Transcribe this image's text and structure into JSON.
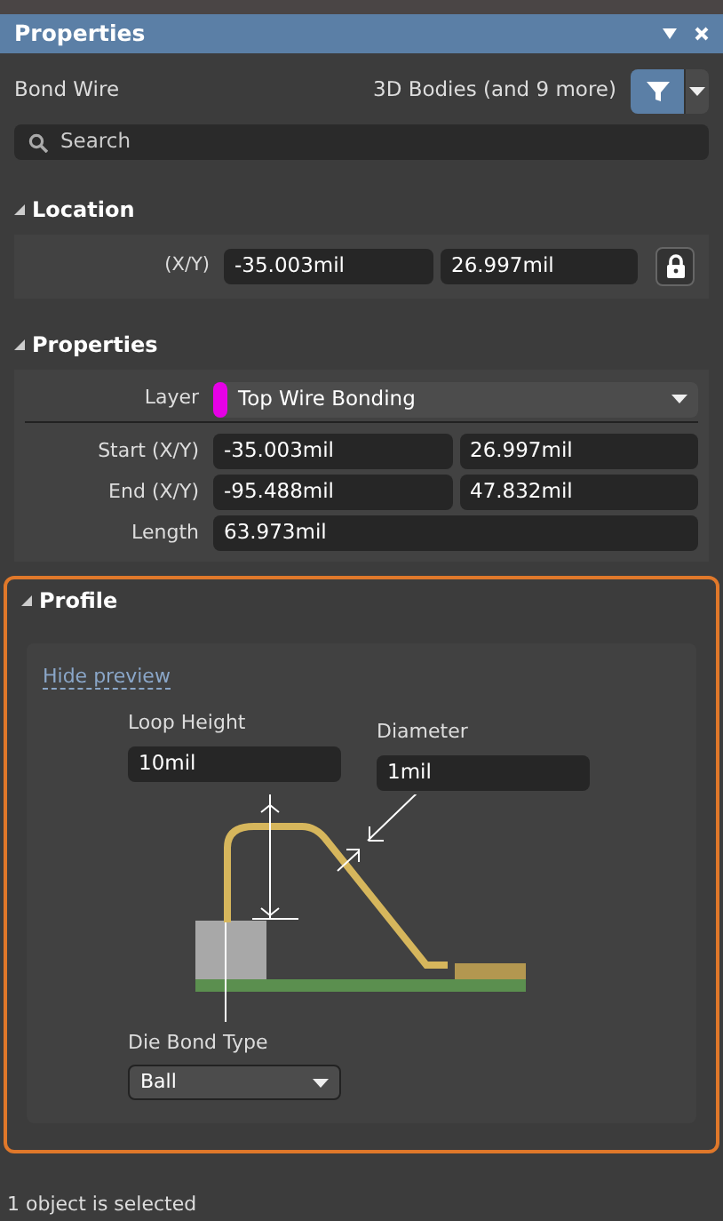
{
  "window": {
    "title": "Properties"
  },
  "object_type": "Bond Wire",
  "filter": {
    "label": "3D Bodies (and 9 more)",
    "active": true
  },
  "search": {
    "placeholder": "Search"
  },
  "location": {
    "title": "Location",
    "expanded": true,
    "label": "(X/Y)",
    "x": "-35.003mil",
    "y": "26.997mil"
  },
  "properties": {
    "title": "Properties",
    "expanded": true,
    "layer": {
      "label": "Layer",
      "value": "Top Wire Bonding",
      "color": "#e600e6"
    },
    "rows": [
      {
        "label": "Start (X/Y)",
        "values": [
          "-35.003mil",
          "26.997mil"
        ]
      },
      {
        "label": "End (X/Y)",
        "values": [
          "-95.488mil",
          "47.832mil"
        ]
      },
      {
        "label": "Length",
        "values": [
          "63.973mil"
        ]
      }
    ]
  },
  "profile": {
    "title": "Profile",
    "expanded": true,
    "highlighted": true,
    "preview_link": "Hide preview",
    "loop_height": {
      "label": "Loop Height",
      "value": "10mil"
    },
    "diameter": {
      "label": "Diameter",
      "value": "1mil"
    },
    "die_bond_type": {
      "label": "Die Bond Type",
      "value": "Ball"
    }
  },
  "status_bar": "1 object is selected"
}
